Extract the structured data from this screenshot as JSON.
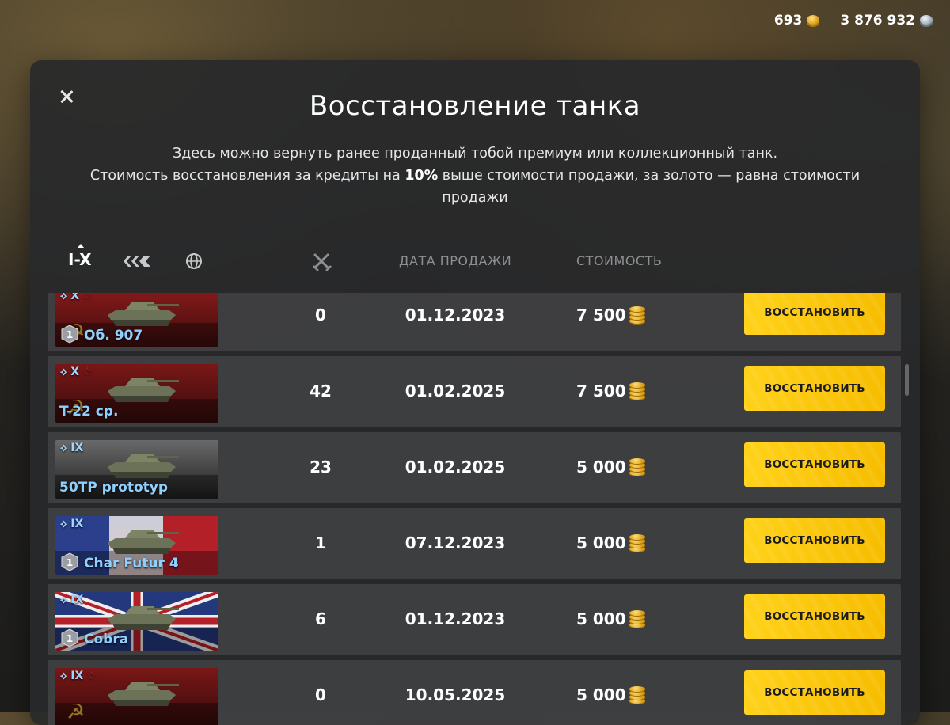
{
  "currency": {
    "gold": "693",
    "credits": "3 876 932"
  },
  "modal": {
    "title": "Восстановление танка",
    "desc_line1": "Здесь можно вернуть ранее проданный тобой премиум или коллекционный танк.",
    "desc_line2_pre": "Стоимость восстановления за кредиты на ",
    "desc_line2_bold": "10%",
    "desc_line2_post": " выше стоимости продажи, за золото — равна стоимости продажи"
  },
  "filters": {
    "tier_label": "I-X"
  },
  "columns": {
    "date": "ДАТА ПРОДАЖИ",
    "cost": "СТОИМОСТЬ"
  },
  "rows": [
    {
      "tier": "X",
      "name": "Об. 907",
      "battles": "0",
      "date": "01.12.2023",
      "cost": "7 500",
      "button": "ВОССТАНОВИТЬ"
    },
    {
      "tier": "X",
      "name": "T-22 ср.",
      "battles": "42",
      "date": "01.02.2025",
      "cost": "7 500",
      "button": "ВОССТАНОВИТЬ"
    },
    {
      "tier": "IX",
      "name": "50TP prototyp",
      "battles": "23",
      "date": "01.02.2025",
      "cost": "5 000",
      "button": "ВОССТАНОВИТЬ"
    },
    {
      "tier": "IX",
      "name": "Char Futur 4",
      "battles": "1",
      "date": "07.12.2023",
      "cost": "5 000",
      "button": "ВОССТАНОВИТЬ"
    },
    {
      "tier": "IX",
      "name": "Cobra",
      "battles": "6",
      "date": "01.12.2023",
      "cost": "5 000",
      "button": "ВОССТАНОВИТЬ"
    },
    {
      "tier": "IX",
      "name": "",
      "battles": "0",
      "date": "10.05.2025",
      "cost": "5 000",
      "button": "ВОССТАНОВИТЬ"
    }
  ],
  "colors": {
    "accent": "#ffd21a",
    "tank_name": "#8fd0ff",
    "panel": "#28292b"
  }
}
